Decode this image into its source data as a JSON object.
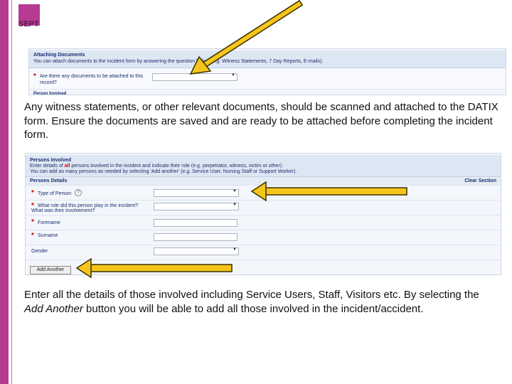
{
  "brand": {
    "logo_text": "SEPT",
    "color": "#b83a93"
  },
  "attaching_panel": {
    "title": "Attaching Documents",
    "intro": "You can attach documents to the incident form by answering the question below (e.g. Witness Statements, 7 Day Reports, E-mails).",
    "question": "Are there any documents to be attached to this record?",
    "partial_text": "Person Involved"
  },
  "paragraph1": "Any witness statements, or other relevant documents, should be scanned and attached to the DATIX form. Ensure the documents are saved and are ready to be attached before completing the incident form.",
  "persons_panel": {
    "title": "Persons Involved",
    "intro_line1_a": "Enter details of ",
    "intro_line1_b": "all",
    "intro_line1_c": " persons involved in the incident and indicate their role (e.g. perpetrator, witness, victim or other).",
    "intro_line2": "You can add as many persons as needed by selecting 'Add another' (e.g. Service User, Nursing Staff or Support Worker).",
    "details_heading": "Persons Details",
    "clear_section": "Clear Section",
    "fields": {
      "type_of_person": "Type of Person",
      "role_line1": "What role did this person play in the incident?",
      "role_line2": "What was their involvement?",
      "forename": "Forename",
      "surname": "Surname",
      "gender": "Gender"
    },
    "add_another": "Add Another"
  },
  "paragraph2": {
    "before": "Enter all the details of those involved including Service Users, Staff, Visitors etc. By selecting the ",
    "emphasis": "Add Another",
    "after": " button you will be able to add all those involved in the incident/accident."
  },
  "arrow_color": "#f5c51b"
}
